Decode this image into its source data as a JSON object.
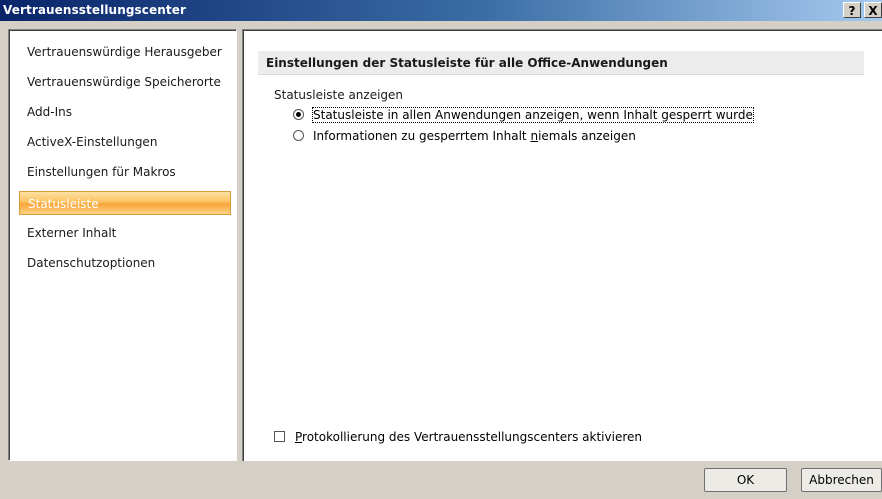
{
  "window": {
    "title": "Vertrauensstellungscenter",
    "help_label": "?",
    "close_label": "X"
  },
  "nav": {
    "items": [
      {
        "label": "Vertrauenswürdige Herausgeber",
        "selected": false
      },
      {
        "label": "Vertrauenswürdige Speicherorte",
        "selected": false
      },
      {
        "label": "Add-Ins",
        "selected": false
      },
      {
        "label": "ActiveX-Einstellungen",
        "selected": false
      },
      {
        "label": "Einstellungen für Makros",
        "selected": false
      },
      {
        "label": "Statusleiste",
        "selected": true
      },
      {
        "label": "Externer Inhalt",
        "selected": false
      },
      {
        "label": "Datenschutzoptionen",
        "selected": false
      }
    ]
  },
  "content": {
    "section_header": "Einstellungen der Statusleiste für alle Office-Anwendungen",
    "group_label": "Statusleiste anzeigen",
    "options": [
      {
        "label": "Statusleiste in allen Anwendungen anzeigen, wenn Inhalt gesperrt wurde",
        "checked": true
      },
      {
        "label_before": "Informationen zu gesperrtem Inhalt ",
        "label_accel": "n",
        "label_after": "iemals anzeigen",
        "checked": false
      }
    ],
    "logging": {
      "label_accel": "P",
      "label_rest": "rotokollierung des Vertrauensstellungscenters aktivieren",
      "checked": false
    }
  },
  "buttons": {
    "ok": "OK",
    "cancel": "Abbrechen"
  }
}
